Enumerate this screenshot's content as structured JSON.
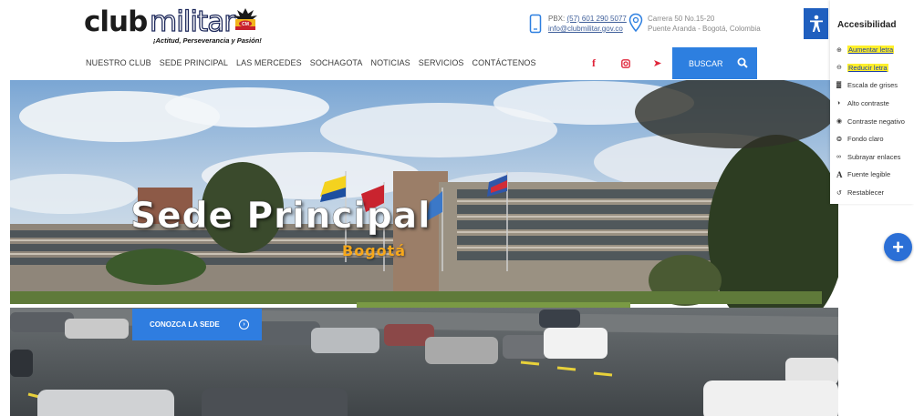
{
  "logo": {
    "name_part1": "club",
    "name_part2": "militar",
    "emblem_text": "CM",
    "slogan": "¡Actitud, Perseverancia y Pasión!"
  },
  "contact": {
    "phone_label": "PBX:",
    "phone": "(57) 601 290 5077",
    "email": "info@clubmilitar.gov.co",
    "address_line1": "Carrera 50 No.15-20",
    "address_line2": "Puente Aranda - Bogotá, Colombia",
    "phone_icon": "phone-icon",
    "pin_icon": "map-pin-icon"
  },
  "nav": {
    "items": [
      "NUESTRO CLUB",
      "SEDE PRINCIPAL",
      "LAS MERCEDES",
      "SOCHAGOTA",
      "NOTICIAS",
      "SERVICIOS",
      "CONTÁCTENOS"
    ]
  },
  "social": {
    "facebook": "f",
    "instagram": "◙",
    "youtube": "▶",
    "color": "#e0263b"
  },
  "search": {
    "label": "BUSCAR",
    "icon": "search-icon",
    "color": "#2d7fe0"
  },
  "hero": {
    "title": "Sede Principal",
    "subtitle": "Bogotá",
    "cta_label": "CONOZCA LA SEDE",
    "cta_icon": "circle-arrow-icon",
    "subtitle_color": "#f7a81b"
  },
  "accessibility": {
    "title": "Accesibilidad",
    "toggle_icon": "accessibility-person-icon",
    "items": [
      {
        "label": "Aumentar letra",
        "icon": "zoom-in-icon",
        "highlighted": true
      },
      {
        "label": "Reducir letra",
        "icon": "zoom-out-icon",
        "highlighted": true
      },
      {
        "label": "Escala de grises",
        "icon": "grayscale-icon",
        "highlighted": false
      },
      {
        "label": "Alto contraste",
        "icon": "contrast-icon",
        "highlighted": false
      },
      {
        "label": "Contraste negativo",
        "icon": "eye-icon",
        "highlighted": false
      },
      {
        "label": "Fondo claro",
        "icon": "lightbulb-icon",
        "highlighted": false
      },
      {
        "label": "Subrayar enlaces",
        "icon": "link-icon",
        "highlighted": false
      },
      {
        "label": "Fuente legible",
        "icon": "font-icon",
        "highlighted": false
      },
      {
        "label": "Restablecer",
        "icon": "reset-icon",
        "highlighted": false
      }
    ],
    "highlight_color": "#ffef2b"
  },
  "fab": {
    "label": "+",
    "icon": "plus-icon"
  }
}
